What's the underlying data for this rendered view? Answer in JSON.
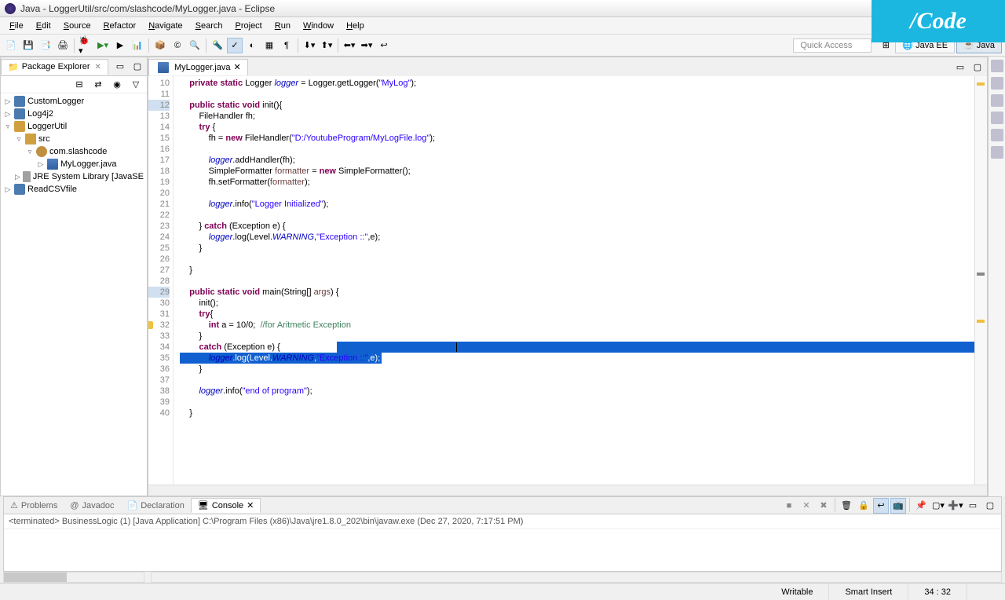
{
  "window": {
    "title": "Java - LoggerUtil/src/com/slashcode/MyLogger.java - Eclipse"
  },
  "watermark": "/Code",
  "menubar": [
    "File",
    "Edit",
    "Source",
    "Refactor",
    "Navigate",
    "Search",
    "Project",
    "Run",
    "Window",
    "Help"
  ],
  "quick_access": "Quick Access",
  "perspectives": {
    "java_ee": "Java EE",
    "java": "Java"
  },
  "explorer": {
    "title": "Package Explorer",
    "items": [
      {
        "label": "CustomLogger",
        "depth": 0,
        "toggle": "▷",
        "icon": "icon-project"
      },
      {
        "label": "Log4j2",
        "depth": 0,
        "toggle": "▷",
        "icon": "icon-project"
      },
      {
        "label": "LoggerUtil",
        "depth": 0,
        "toggle": "▿",
        "icon": "icon-project-open"
      },
      {
        "label": "src",
        "depth": 1,
        "toggle": "▿",
        "icon": "icon-folder"
      },
      {
        "label": "com.slashcode",
        "depth": 2,
        "toggle": "▿",
        "icon": "icon-package"
      },
      {
        "label": "MyLogger.java",
        "depth": 3,
        "toggle": "▷",
        "icon": "icon-java"
      },
      {
        "label": "JRE System Library [JavaSE",
        "depth": 1,
        "toggle": "▷",
        "icon": "icon-jre"
      },
      {
        "label": "ReadCSVfile",
        "depth": 0,
        "toggle": "▷",
        "icon": "icon-project"
      }
    ]
  },
  "editor": {
    "tab": "MyLogger.java",
    "lines": [
      {
        "n": 10,
        "html": "    <span class='kw'>private static</span> Logger <span class='fld'>logger</span> = Logger.getLogger(<span class='str'>\"MyLog\"</span>);"
      },
      {
        "n": 11,
        "html": ""
      },
      {
        "n": 12,
        "html": "    <span class='kw'>public static void</span> init(){",
        "ms": true
      },
      {
        "n": 13,
        "html": "        FileHandler fh;"
      },
      {
        "n": 14,
        "html": "        <span class='kw'>try</span> {"
      },
      {
        "n": 15,
        "html": "            fh = <span class='kw'>new</span> FileHandler(<span class='str'>\"D:/YoutubeProgram/MyLogFile.log\"</span>);"
      },
      {
        "n": 16,
        "html": ""
      },
      {
        "n": 17,
        "html": "            <span class='fld'>logger</span>.addHandler(fh);"
      },
      {
        "n": 18,
        "html": "            SimpleFormatter <span class='var'>formatter</span> = <span class='kw'>new</span> SimpleFormatter();"
      },
      {
        "n": 19,
        "html": "            fh.setFormatter(<span class='var'>formatter</span>);"
      },
      {
        "n": 20,
        "html": ""
      },
      {
        "n": 21,
        "html": "            <span class='fld'>logger</span>.info(<span class='str'>\"Logger Initialized\"</span>);"
      },
      {
        "n": 22,
        "html": ""
      },
      {
        "n": 23,
        "html": "        } <span class='kw'>catch</span> (Exception e) {"
      },
      {
        "n": 24,
        "html": "            <span class='fld'>logger</span>.log(Level.<span class='fld'>WARNING</span>,<span class='str'>\"Exception ::\"</span>,e);"
      },
      {
        "n": 25,
        "html": "        }"
      },
      {
        "n": 26,
        "html": ""
      },
      {
        "n": 27,
        "html": "    }"
      },
      {
        "n": 28,
        "html": ""
      },
      {
        "n": 29,
        "html": "    <span class='kw'>public static void</span> main(String[] <span class='var'>args</span>) {",
        "ms": true
      },
      {
        "n": 30,
        "html": "        init();"
      },
      {
        "n": 31,
        "html": "        <span class='kw'>try</span>{"
      },
      {
        "n": 32,
        "html": "            <span class='kw'>int</span> a = 10/0;  <span class='cm'>//for Aritmetic Exception</span>",
        "warn": true
      },
      {
        "n": 33,
        "html": "        }"
      },
      {
        "n": 34,
        "html": "        <span class='kw'>catch</span> (Exception e) { ",
        "sel_from": true
      },
      {
        "n": 35,
        "html": "            <span class='fld'>logger</span>.log(Level.<span class='fld'>WARNING</span>,<span class='str'>\"Exception ::\"</span>,e);",
        "sel_to": true
      },
      {
        "n": 36,
        "html": "        }"
      },
      {
        "n": 37,
        "html": ""
      },
      {
        "n": 38,
        "html": "        <span class='fld'>logger</span>.info(<span class='str'>\"end of program\"</span>);"
      },
      {
        "n": 39,
        "html": ""
      },
      {
        "n": 40,
        "html": "    }"
      }
    ]
  },
  "bottom": {
    "tabs": {
      "problems": "Problems",
      "javadoc": "Javadoc",
      "declaration": "Declaration",
      "console": "Console"
    },
    "console_status": "<terminated> BusinessLogic (1) [Java Application] C:\\Program Files (x86)\\Java\\jre1.8.0_202\\bin\\javaw.exe (Dec 27, 2020, 7:17:51 PM)"
  },
  "statusbar": {
    "writable": "Writable",
    "insert": "Smart Insert",
    "pos": "34 : 32"
  }
}
